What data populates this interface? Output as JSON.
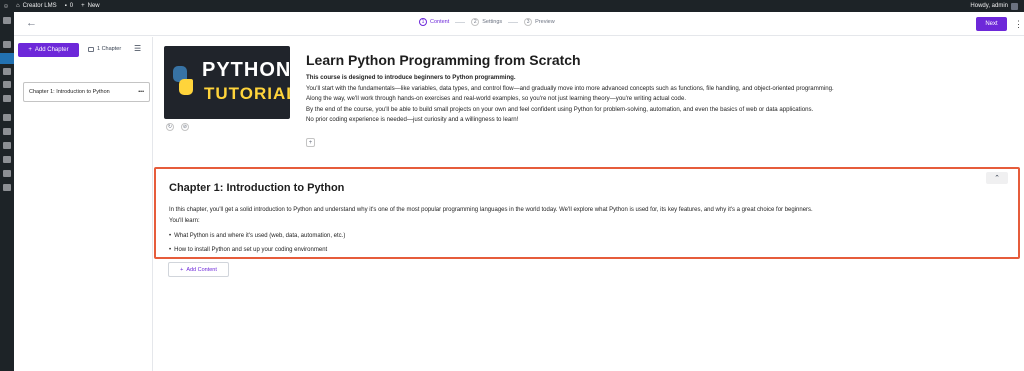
{
  "admin_bar": {
    "site_name": "Creator LMS",
    "comments_count": "0",
    "new_label": "New",
    "greeting": "Howdy, admin"
  },
  "header": {
    "steps": [
      {
        "number": "1",
        "label": "Content"
      },
      {
        "number": "2",
        "label": "Settings"
      },
      {
        "number": "3",
        "label": "Preview"
      }
    ],
    "next_label": "Next"
  },
  "sidebar": {
    "add_chapter_label": "Add Chapter",
    "chapter_count": "1 Chapter",
    "chapters": [
      {
        "title": "Chapter 1: Introduction to Python"
      }
    ]
  },
  "course": {
    "thumbnail_line1": "PYTHON",
    "thumbnail_line2": "TUTORIAL",
    "title": "Learn Python Programming from Scratch",
    "description_bold": "This course is designed to introduce beginners to Python programming.",
    "description_lines": [
      "You'll start with the fundamentals—like variables, data types, and control flow—and gradually move into more advanced concepts such as functions, file handling, and object-oriented programming.",
      "Along the way, we'll work through hands-on exercises and real-world examples, so you're not just learning theory—you're writing actual code.",
      "By the end of the course, you'll be able to build small projects on your own and feel confident using Python for problem-solving, automation, and even the basics of web or data applications.",
      "No prior coding experience is needed—just curiosity and a willingness to learn!"
    ]
  },
  "chapter": {
    "title": "Chapter 1: Introduction to Python",
    "intro": "In this chapter, you'll get a solid introduction to Python and understand why it's one of the most popular programming languages in the world today. We'll explore what Python is used for, its key features, and why it's a great choice for beginners.",
    "learn_label": "You'll learn:",
    "bullets": [
      "What Python is and where it's used (web, data, automation, etc.)",
      "How to install Python and set up your coding environment"
    ]
  },
  "add_content_label": "Add Content",
  "colors": {
    "accent": "#6d28d9",
    "highlight_border": "#e65c3b",
    "admin_bar": "#1d2327"
  }
}
